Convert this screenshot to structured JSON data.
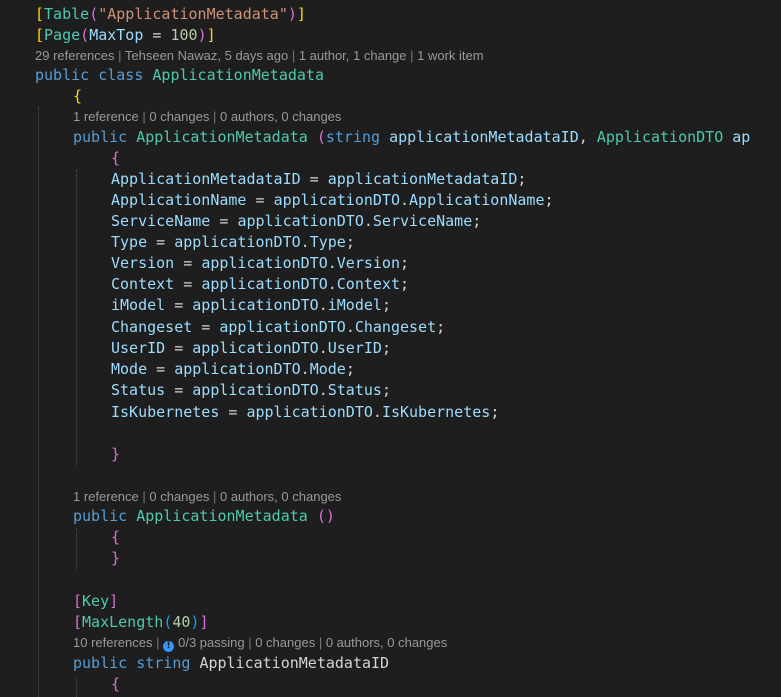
{
  "code": {
    "table_attr": "Table",
    "table_name": "\"ApplicationMetadata\"",
    "page_attr": "Page",
    "max_top": "MaxTop",
    "max_top_value": "100",
    "kw_public": "public",
    "kw_class": "class",
    "kw_string": "string",
    "class_name": "ApplicationMetadata",
    "ctor_param1_type": "string",
    "ctor_param1_name": "applicationMetadataID",
    "ctor_param2_type": "ApplicationDTO",
    "ctor_param2_name_partial": "ap",
    "assignments": [
      {
        "lhs": "ApplicationMetadataID",
        "rhs_obj": "applicationMetadataID",
        "rhs_prop": ""
      },
      {
        "lhs": "ApplicationName",
        "rhs_obj": "applicationDTO",
        "rhs_prop": "ApplicationName"
      },
      {
        "lhs": "ServiceName",
        "rhs_obj": "applicationDTO",
        "rhs_prop": "ServiceName"
      },
      {
        "lhs": "Type",
        "rhs_obj": "applicationDTO",
        "rhs_prop": "Type"
      },
      {
        "lhs": "Version",
        "rhs_obj": "applicationDTO",
        "rhs_prop": "Version"
      },
      {
        "lhs": "Context",
        "rhs_obj": "applicationDTO",
        "rhs_prop": "Context"
      },
      {
        "lhs": "iModel",
        "rhs_obj": "applicationDTO",
        "rhs_prop": "iModel"
      },
      {
        "lhs": "Changeset",
        "rhs_obj": "applicationDTO",
        "rhs_prop": "Changeset"
      },
      {
        "lhs": "UserID",
        "rhs_obj": "applicationDTO",
        "rhs_prop": "UserID"
      },
      {
        "lhs": "Mode",
        "rhs_obj": "applicationDTO",
        "rhs_prop": "Mode"
      },
      {
        "lhs": "Status",
        "rhs_obj": "applicationDTO",
        "rhs_prop": "Status"
      },
      {
        "lhs": "IsKubernetes",
        "rhs_obj": "applicationDTO",
        "rhs_prop": "IsKubernetes"
      }
    ],
    "key_attr": "Key",
    "maxlength_attr": "MaxLength",
    "maxlength_value": "40",
    "property_name": "ApplicationMetadataID"
  },
  "codelens": {
    "class": {
      "references": "29 references",
      "author": "Tehseen Nawaz, 5 days ago",
      "authors": "1 author, 1 change",
      "work_items": "1 work item"
    },
    "ctor1": {
      "references": "1 reference",
      "changes": "0 changes",
      "authors": "0 authors, 0 changes"
    },
    "ctor2": {
      "references": "1 reference",
      "changes": "0 changes",
      "authors": "0 authors, 0 changes"
    },
    "property": {
      "references": "10 references",
      "tests": "0/3 passing",
      "changes": "0 changes",
      "authors": "0 authors, 0 changes"
    }
  },
  "colors": {
    "background": "#1e1e1e",
    "keyword": "#569cd6",
    "type": "#4ec9b0",
    "string": "#ce9178",
    "number": "#b5cea8",
    "identifier": "#9cdcfe",
    "codelens": "#999999"
  },
  "icons": {
    "test_status": "info-icon"
  }
}
